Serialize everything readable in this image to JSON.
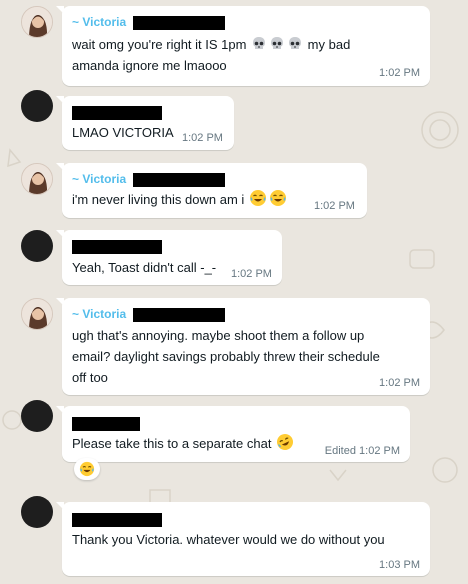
{
  "chat": {
    "messages": [
      {
        "sender": "~ Victoria",
        "text_a": "wait omg you're right it IS 1pm ",
        "text_b": " my bad",
        "text_c": "amanda ignore me lmaooo",
        "time": "1:02 PM"
      },
      {
        "text": "LMAO VICTORIA",
        "time": "1:02 PM"
      },
      {
        "sender": "~ Victoria",
        "text": "i'm never living this down am i ",
        "time": "1:02 PM"
      },
      {
        "text": "Yeah, Toast didn't call -_-",
        "time": "1:02 PM"
      },
      {
        "sender": "~ Victoria",
        "text_a": "ugh that's annoying. maybe shoot them a follow up",
        "text_b": "email? daylight savings probably threw their schedule",
        "text_c": "off too",
        "time": "1:02 PM"
      },
      {
        "text": "Please take this to a separate chat ",
        "edited": "Edited",
        "time": "1:02 PM",
        "reaction": "laughing-emoji"
      },
      {
        "text": "Thank you Victoria. whatever would we do without you",
        "time": "1:03 PM"
      }
    ]
  },
  "colors": {
    "wallpaper": "#eae6df",
    "bubble": "#ffffff",
    "sender_name": "#53bdeb",
    "timestamp": "#667781"
  },
  "icons": [
    "skull-emoji",
    "crying-laughing-emoji",
    "rofl-emoji",
    "laughing-emoji",
    "contact-avatar"
  ]
}
